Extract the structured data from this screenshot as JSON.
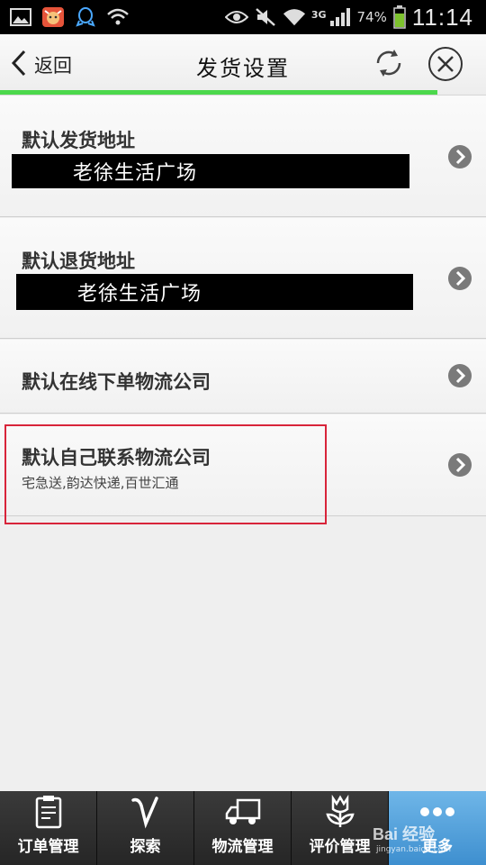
{
  "status_bar": {
    "battery_percent": "74%",
    "network": "3G",
    "time": "11:14"
  },
  "header": {
    "back_label": "返回",
    "title": "发货设置",
    "progress": 0.9,
    "accent_color": "#4cd84c"
  },
  "rows": [
    {
      "title": "默认发货地址",
      "value": "老徐生活广场"
    },
    {
      "title": "默认退货地址",
      "value": "老徐生活广场"
    },
    {
      "title": "默认在线下单物流公司"
    },
    {
      "title": "默认自己联系物流公司",
      "subtitle": "宅急送,韵达快递,百世汇通"
    }
  ],
  "bottom_nav": {
    "tabs": [
      {
        "label": "订单管理",
        "icon": "clipboard-icon"
      },
      {
        "label": "探索",
        "icon": "v-explore-icon"
      },
      {
        "label": "物流管理",
        "icon": "truck-icon"
      },
      {
        "label": "评价管理",
        "icon": "flower-icon"
      },
      {
        "label": "更多",
        "icon": "more-dots-icon",
        "active": true
      }
    ]
  },
  "watermark": {
    "brand": "Bai 经验",
    "url": "jingyan.baidu.com"
  },
  "colors": {
    "highlight": "#d8243a",
    "active_tab": "#4a9ad8",
    "status_bar": "#000000"
  }
}
